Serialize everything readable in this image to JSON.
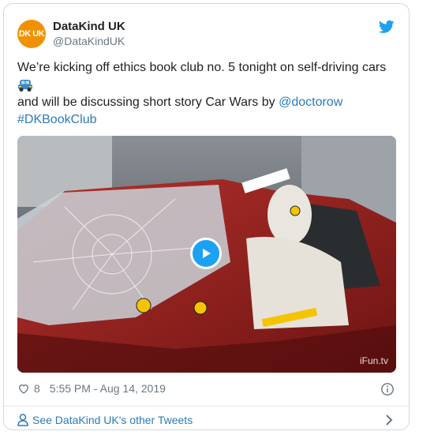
{
  "author": {
    "name": "DataKind UK",
    "handle": "@DataKindUK",
    "avatar_text": "DK UK"
  },
  "tweet": {
    "line1": "We’re kicking off ethics book club no. 5 tonight on self-driving cars",
    "line2_prefix": "and will be discussing short story Car Wars by ",
    "mention": "@doctorow",
    "hashtag": "#DKBookClub",
    "car_emoji_name": "car-icon"
  },
  "media": {
    "watermark": "iFun.tv",
    "play_icon": "play-icon",
    "accent": "#1da1f2"
  },
  "meta": {
    "likes": "8",
    "timestamp": "5:55 PM - Aug 14, 2019"
  },
  "footer": {
    "link_text": "See DataKind UK's other Tweets"
  },
  "colors": {
    "link": "#2b7bb9",
    "muted": "#697882",
    "avatar_bg": "#f29100",
    "bird": "#1da1f2"
  }
}
